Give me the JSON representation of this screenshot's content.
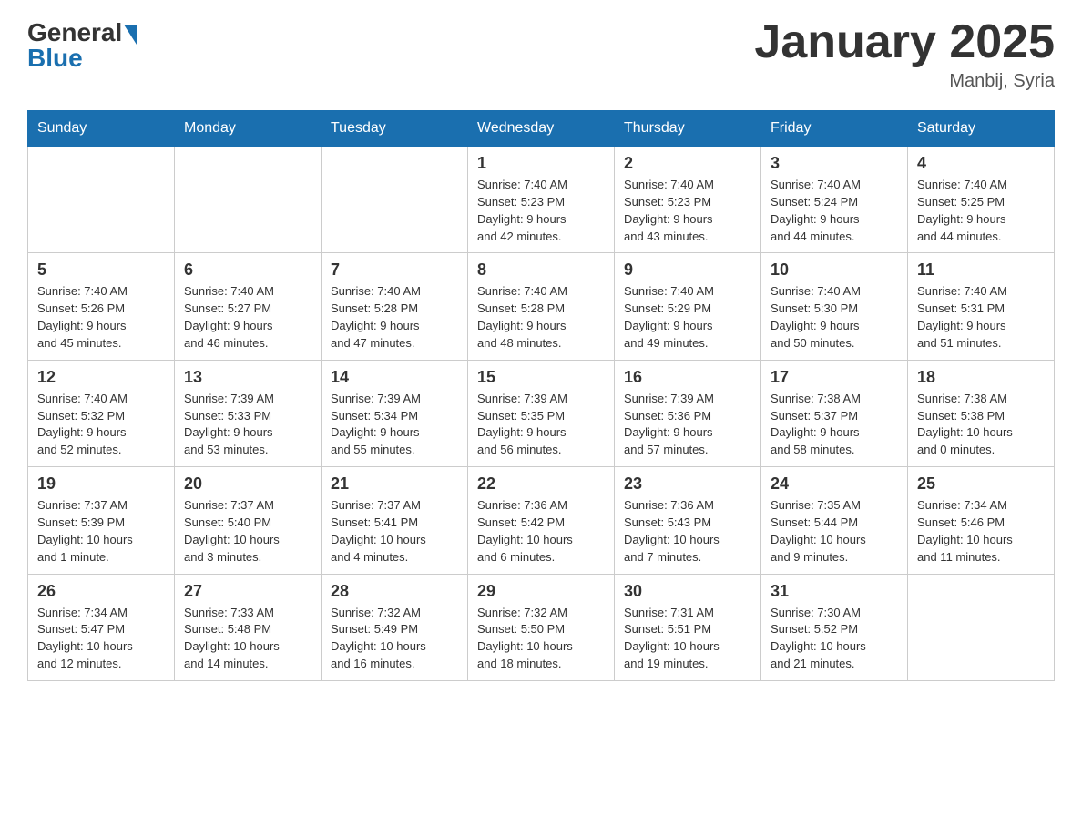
{
  "header": {
    "logo_general": "General",
    "logo_blue": "Blue",
    "month_title": "January 2025",
    "location": "Manbij, Syria"
  },
  "days_of_week": [
    "Sunday",
    "Monday",
    "Tuesday",
    "Wednesday",
    "Thursday",
    "Friday",
    "Saturday"
  ],
  "weeks": [
    [
      {
        "day": "",
        "info": ""
      },
      {
        "day": "",
        "info": ""
      },
      {
        "day": "",
        "info": ""
      },
      {
        "day": "1",
        "info": "Sunrise: 7:40 AM\nSunset: 5:23 PM\nDaylight: 9 hours\nand 42 minutes."
      },
      {
        "day": "2",
        "info": "Sunrise: 7:40 AM\nSunset: 5:23 PM\nDaylight: 9 hours\nand 43 minutes."
      },
      {
        "day": "3",
        "info": "Sunrise: 7:40 AM\nSunset: 5:24 PM\nDaylight: 9 hours\nand 44 minutes."
      },
      {
        "day": "4",
        "info": "Sunrise: 7:40 AM\nSunset: 5:25 PM\nDaylight: 9 hours\nand 44 minutes."
      }
    ],
    [
      {
        "day": "5",
        "info": "Sunrise: 7:40 AM\nSunset: 5:26 PM\nDaylight: 9 hours\nand 45 minutes."
      },
      {
        "day": "6",
        "info": "Sunrise: 7:40 AM\nSunset: 5:27 PM\nDaylight: 9 hours\nand 46 minutes."
      },
      {
        "day": "7",
        "info": "Sunrise: 7:40 AM\nSunset: 5:28 PM\nDaylight: 9 hours\nand 47 minutes."
      },
      {
        "day": "8",
        "info": "Sunrise: 7:40 AM\nSunset: 5:28 PM\nDaylight: 9 hours\nand 48 minutes."
      },
      {
        "day": "9",
        "info": "Sunrise: 7:40 AM\nSunset: 5:29 PM\nDaylight: 9 hours\nand 49 minutes."
      },
      {
        "day": "10",
        "info": "Sunrise: 7:40 AM\nSunset: 5:30 PM\nDaylight: 9 hours\nand 50 minutes."
      },
      {
        "day": "11",
        "info": "Sunrise: 7:40 AM\nSunset: 5:31 PM\nDaylight: 9 hours\nand 51 minutes."
      }
    ],
    [
      {
        "day": "12",
        "info": "Sunrise: 7:40 AM\nSunset: 5:32 PM\nDaylight: 9 hours\nand 52 minutes."
      },
      {
        "day": "13",
        "info": "Sunrise: 7:39 AM\nSunset: 5:33 PM\nDaylight: 9 hours\nand 53 minutes."
      },
      {
        "day": "14",
        "info": "Sunrise: 7:39 AM\nSunset: 5:34 PM\nDaylight: 9 hours\nand 55 minutes."
      },
      {
        "day": "15",
        "info": "Sunrise: 7:39 AM\nSunset: 5:35 PM\nDaylight: 9 hours\nand 56 minutes."
      },
      {
        "day": "16",
        "info": "Sunrise: 7:39 AM\nSunset: 5:36 PM\nDaylight: 9 hours\nand 57 minutes."
      },
      {
        "day": "17",
        "info": "Sunrise: 7:38 AM\nSunset: 5:37 PM\nDaylight: 9 hours\nand 58 minutes."
      },
      {
        "day": "18",
        "info": "Sunrise: 7:38 AM\nSunset: 5:38 PM\nDaylight: 10 hours\nand 0 minutes."
      }
    ],
    [
      {
        "day": "19",
        "info": "Sunrise: 7:37 AM\nSunset: 5:39 PM\nDaylight: 10 hours\nand 1 minute."
      },
      {
        "day": "20",
        "info": "Sunrise: 7:37 AM\nSunset: 5:40 PM\nDaylight: 10 hours\nand 3 minutes."
      },
      {
        "day": "21",
        "info": "Sunrise: 7:37 AM\nSunset: 5:41 PM\nDaylight: 10 hours\nand 4 minutes."
      },
      {
        "day": "22",
        "info": "Sunrise: 7:36 AM\nSunset: 5:42 PM\nDaylight: 10 hours\nand 6 minutes."
      },
      {
        "day": "23",
        "info": "Sunrise: 7:36 AM\nSunset: 5:43 PM\nDaylight: 10 hours\nand 7 minutes."
      },
      {
        "day": "24",
        "info": "Sunrise: 7:35 AM\nSunset: 5:44 PM\nDaylight: 10 hours\nand 9 minutes."
      },
      {
        "day": "25",
        "info": "Sunrise: 7:34 AM\nSunset: 5:46 PM\nDaylight: 10 hours\nand 11 minutes."
      }
    ],
    [
      {
        "day": "26",
        "info": "Sunrise: 7:34 AM\nSunset: 5:47 PM\nDaylight: 10 hours\nand 12 minutes."
      },
      {
        "day": "27",
        "info": "Sunrise: 7:33 AM\nSunset: 5:48 PM\nDaylight: 10 hours\nand 14 minutes."
      },
      {
        "day": "28",
        "info": "Sunrise: 7:32 AM\nSunset: 5:49 PM\nDaylight: 10 hours\nand 16 minutes."
      },
      {
        "day": "29",
        "info": "Sunrise: 7:32 AM\nSunset: 5:50 PM\nDaylight: 10 hours\nand 18 minutes."
      },
      {
        "day": "30",
        "info": "Sunrise: 7:31 AM\nSunset: 5:51 PM\nDaylight: 10 hours\nand 19 minutes."
      },
      {
        "day": "31",
        "info": "Sunrise: 7:30 AM\nSunset: 5:52 PM\nDaylight: 10 hours\nand 21 minutes."
      },
      {
        "day": "",
        "info": ""
      }
    ]
  ]
}
